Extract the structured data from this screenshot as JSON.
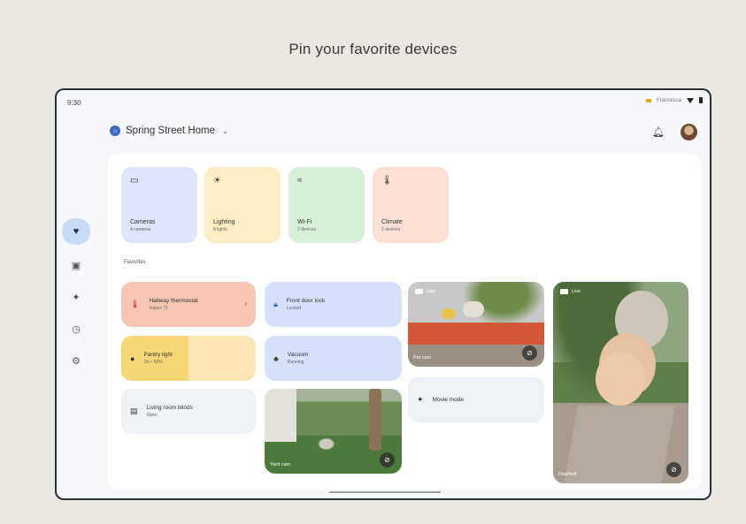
{
  "headline": "Pin your favorite devices",
  "status": {
    "time": "9:30",
    "network": "Francesca"
  },
  "home": {
    "name": "Spring Street Home"
  },
  "tiles": [
    {
      "name": "Cameras",
      "sub": "4 cameras"
    },
    {
      "name": "Lighting",
      "sub": "8 lights"
    },
    {
      "name": "Wi-Fi",
      "sub": "2 devices"
    },
    {
      "name": "Climate",
      "sub": "2 devices"
    }
  ],
  "favorites_title": "Favorites",
  "favorites": {
    "thermostat": {
      "name": "Hallway thermostat",
      "sub": "Indoor 70"
    },
    "pantry": {
      "name": "Pantry light",
      "sub": "On • 50%"
    },
    "blinds": {
      "name": "Living room blinds",
      "sub": "Open"
    },
    "lock": {
      "name": "Front door lock",
      "sub": "Locked"
    },
    "vacuum": {
      "name": "Vacuum",
      "sub": "Running"
    },
    "movie": {
      "name": "Movie mode"
    }
  },
  "cameras": {
    "sofa": {
      "live": "Live",
      "label": "Pet cam"
    },
    "yard": {
      "label": "Yard cam"
    },
    "door": {
      "live": "Live",
      "label": "Doorbell"
    }
  },
  "colors": {
    "rail_active": "#c9dcf7",
    "tile_camera": "#dfe5fb",
    "tile_lighting": "#fdedc2",
    "tile_wifi": "#d9f0d8",
    "tile_climate": "#fde0d6"
  }
}
